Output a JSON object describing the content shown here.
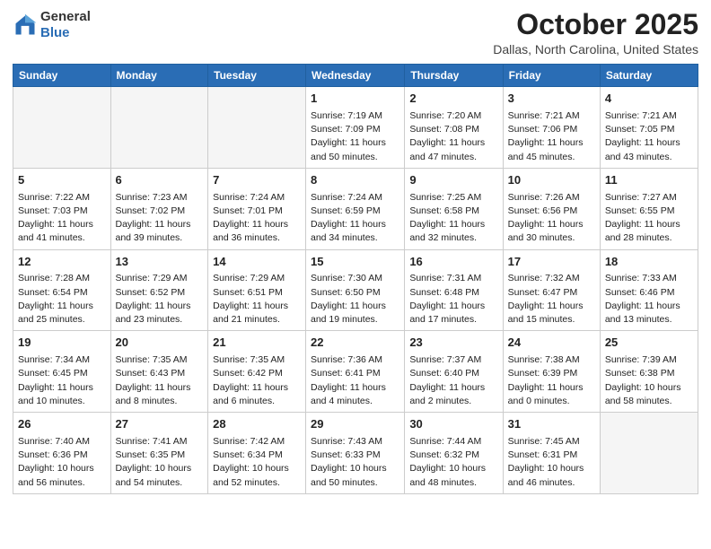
{
  "header": {
    "logo": {
      "general": "General",
      "blue": "Blue"
    },
    "title": "October 2025",
    "location": "Dallas, North Carolina, United States"
  },
  "days_of_week": [
    "Sunday",
    "Monday",
    "Tuesday",
    "Wednesday",
    "Thursday",
    "Friday",
    "Saturday"
  ],
  "weeks": [
    [
      {
        "day": "",
        "info": ""
      },
      {
        "day": "",
        "info": ""
      },
      {
        "day": "",
        "info": ""
      },
      {
        "day": "1",
        "info": "Sunrise: 7:19 AM\nSunset: 7:09 PM\nDaylight: 11 hours and 50 minutes."
      },
      {
        "day": "2",
        "info": "Sunrise: 7:20 AM\nSunset: 7:08 PM\nDaylight: 11 hours and 47 minutes."
      },
      {
        "day": "3",
        "info": "Sunrise: 7:21 AM\nSunset: 7:06 PM\nDaylight: 11 hours and 45 minutes."
      },
      {
        "day": "4",
        "info": "Sunrise: 7:21 AM\nSunset: 7:05 PM\nDaylight: 11 hours and 43 minutes."
      }
    ],
    [
      {
        "day": "5",
        "info": "Sunrise: 7:22 AM\nSunset: 7:03 PM\nDaylight: 11 hours and 41 minutes."
      },
      {
        "day": "6",
        "info": "Sunrise: 7:23 AM\nSunset: 7:02 PM\nDaylight: 11 hours and 39 minutes."
      },
      {
        "day": "7",
        "info": "Sunrise: 7:24 AM\nSunset: 7:01 PM\nDaylight: 11 hours and 36 minutes."
      },
      {
        "day": "8",
        "info": "Sunrise: 7:24 AM\nSunset: 6:59 PM\nDaylight: 11 hours and 34 minutes."
      },
      {
        "day": "9",
        "info": "Sunrise: 7:25 AM\nSunset: 6:58 PM\nDaylight: 11 hours and 32 minutes."
      },
      {
        "day": "10",
        "info": "Sunrise: 7:26 AM\nSunset: 6:56 PM\nDaylight: 11 hours and 30 minutes."
      },
      {
        "day": "11",
        "info": "Sunrise: 7:27 AM\nSunset: 6:55 PM\nDaylight: 11 hours and 28 minutes."
      }
    ],
    [
      {
        "day": "12",
        "info": "Sunrise: 7:28 AM\nSunset: 6:54 PM\nDaylight: 11 hours and 25 minutes."
      },
      {
        "day": "13",
        "info": "Sunrise: 7:29 AM\nSunset: 6:52 PM\nDaylight: 11 hours and 23 minutes."
      },
      {
        "day": "14",
        "info": "Sunrise: 7:29 AM\nSunset: 6:51 PM\nDaylight: 11 hours and 21 minutes."
      },
      {
        "day": "15",
        "info": "Sunrise: 7:30 AM\nSunset: 6:50 PM\nDaylight: 11 hours and 19 minutes."
      },
      {
        "day": "16",
        "info": "Sunrise: 7:31 AM\nSunset: 6:48 PM\nDaylight: 11 hours and 17 minutes."
      },
      {
        "day": "17",
        "info": "Sunrise: 7:32 AM\nSunset: 6:47 PM\nDaylight: 11 hours and 15 minutes."
      },
      {
        "day": "18",
        "info": "Sunrise: 7:33 AM\nSunset: 6:46 PM\nDaylight: 11 hours and 13 minutes."
      }
    ],
    [
      {
        "day": "19",
        "info": "Sunrise: 7:34 AM\nSunset: 6:45 PM\nDaylight: 11 hours and 10 minutes."
      },
      {
        "day": "20",
        "info": "Sunrise: 7:35 AM\nSunset: 6:43 PM\nDaylight: 11 hours and 8 minutes."
      },
      {
        "day": "21",
        "info": "Sunrise: 7:35 AM\nSunset: 6:42 PM\nDaylight: 11 hours and 6 minutes."
      },
      {
        "day": "22",
        "info": "Sunrise: 7:36 AM\nSunset: 6:41 PM\nDaylight: 11 hours and 4 minutes."
      },
      {
        "day": "23",
        "info": "Sunrise: 7:37 AM\nSunset: 6:40 PM\nDaylight: 11 hours and 2 minutes."
      },
      {
        "day": "24",
        "info": "Sunrise: 7:38 AM\nSunset: 6:39 PM\nDaylight: 11 hours and 0 minutes."
      },
      {
        "day": "25",
        "info": "Sunrise: 7:39 AM\nSunset: 6:38 PM\nDaylight: 10 hours and 58 minutes."
      }
    ],
    [
      {
        "day": "26",
        "info": "Sunrise: 7:40 AM\nSunset: 6:36 PM\nDaylight: 10 hours and 56 minutes."
      },
      {
        "day": "27",
        "info": "Sunrise: 7:41 AM\nSunset: 6:35 PM\nDaylight: 10 hours and 54 minutes."
      },
      {
        "day": "28",
        "info": "Sunrise: 7:42 AM\nSunset: 6:34 PM\nDaylight: 10 hours and 52 minutes."
      },
      {
        "day": "29",
        "info": "Sunrise: 7:43 AM\nSunset: 6:33 PM\nDaylight: 10 hours and 50 minutes."
      },
      {
        "day": "30",
        "info": "Sunrise: 7:44 AM\nSunset: 6:32 PM\nDaylight: 10 hours and 48 minutes."
      },
      {
        "day": "31",
        "info": "Sunrise: 7:45 AM\nSunset: 6:31 PM\nDaylight: 10 hours and 46 minutes."
      },
      {
        "day": "",
        "info": ""
      }
    ]
  ]
}
